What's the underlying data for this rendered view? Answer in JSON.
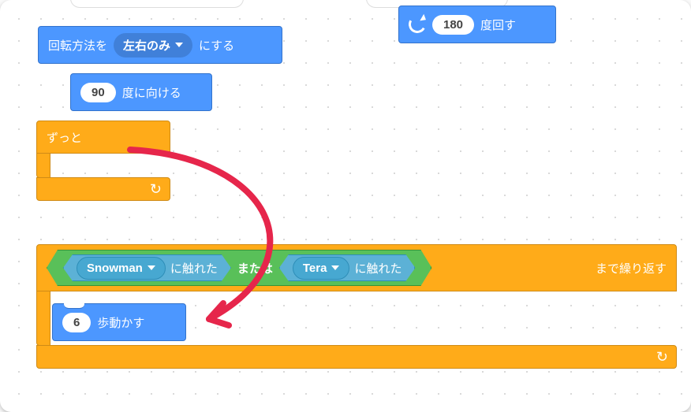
{
  "blocks": {
    "turn": {
      "degrees": "180",
      "label": "度回す"
    },
    "rotationStyle": {
      "prefix": "回転方法を",
      "mode": "左右のみ",
      "suffix": "にする"
    },
    "point": {
      "degrees": "90",
      "label": "度に向ける"
    },
    "forever": {
      "label": "ずっと"
    },
    "repeatUntil": {
      "or": "または",
      "touch1": "に触れた",
      "target1": "Snowman",
      "touch2": "に触れた",
      "target2": "Tera",
      "suffix": "まで繰り返す"
    },
    "move": {
      "steps": "6",
      "label": "歩動かす"
    }
  }
}
